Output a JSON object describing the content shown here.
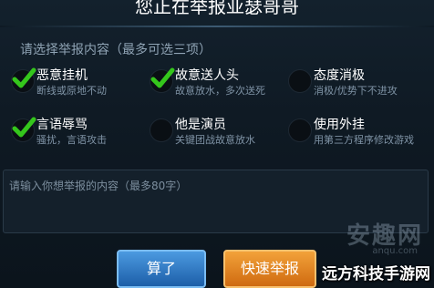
{
  "dialog": {
    "title": "您正在举报亚瑟哥哥",
    "section_label": "请选择举报内容（最多可选三项）",
    "options": [
      {
        "title": "恶意挂机",
        "desc": "断线或原地不动",
        "checked": true
      },
      {
        "title": "故意送人头",
        "desc": "故意放水，多次送死",
        "checked": true
      },
      {
        "title": "态度消极",
        "desc": "消极/优势下不进攻",
        "checked": false
      },
      {
        "title": "言语辱骂",
        "desc": "骚扰，言语攻击",
        "checked": true
      },
      {
        "title": "他是演员",
        "desc": "关键团战故意放水",
        "checked": false
      },
      {
        "title": "使用外挂",
        "desc": "用第三方程序修改游戏",
        "checked": false
      }
    ],
    "input": {
      "placeholder": "请输入你想举报的内容（最多80字）",
      "value": ""
    },
    "buttons": {
      "cancel": "算了",
      "quick_report": "快速举报"
    }
  },
  "watermark": {
    "logo_text": "安趣网",
    "url": "anqu.com",
    "site_name": "远方科技手游网"
  },
  "colors": {
    "check": "#35c61c",
    "cancel_button": "#2f7cc9",
    "quick_button": "#e8891f"
  }
}
